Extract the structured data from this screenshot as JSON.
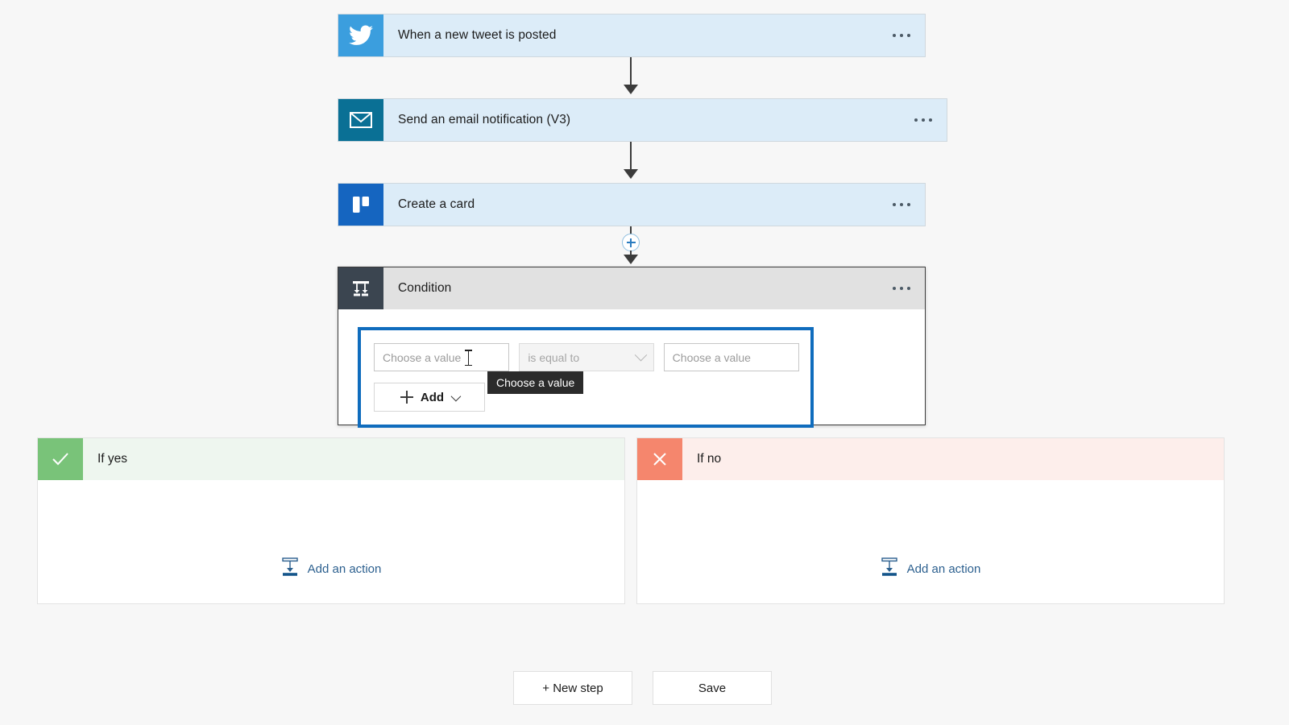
{
  "theme": {
    "page_background": "#f7f7f7",
    "card_background": "#dcecf8",
    "condition_header_background": "#e1e1e1",
    "focus_border": "#0f6cbd",
    "yes_accent": "#79c379",
    "no_accent": "#f5866d",
    "link_color": "#2b5f8e",
    "tooltip_background": "#2b2b2b"
  },
  "flow": {
    "steps": [
      {
        "id": "trigger-tweet",
        "title": "When a new tweet is posted",
        "icon": "twitter-icon",
        "icon_color": "#3b9ede",
        "menu": "overflow-menu-icon"
      },
      {
        "id": "send-email",
        "title": "Send an email notification (V3)",
        "icon": "email-icon",
        "icon_color": "#0a7095",
        "menu": "overflow-menu-icon"
      },
      {
        "id": "create-card",
        "title": "Create a card",
        "icon": "trello-icon",
        "icon_color": "#1565c0",
        "menu": "overflow-menu-icon"
      }
    ],
    "insert_button": {
      "icon": "plus-circle-icon",
      "label": "+"
    },
    "condition": {
      "title": "Condition",
      "icon": "condition-branch-icon",
      "icon_background": "#3b4550",
      "menu": "overflow-menu-icon",
      "row": {
        "left_value": {
          "placeholder": "Choose a value",
          "value": "",
          "cursor": "text-ibeam-cursor"
        },
        "operator": {
          "value": "is equal to",
          "chevron": "chevron-down-icon"
        },
        "right_value": {
          "placeholder": "Choose a value",
          "value": ""
        }
      },
      "add_button": {
        "label": "Add",
        "plus": "plus-icon",
        "chevron": "chevron-down-icon"
      },
      "tooltip": {
        "text": "Choose a value"
      }
    },
    "branches": [
      {
        "id": "if-yes",
        "label": "If yes",
        "icon": "checkmark-icon",
        "add_action": {
          "label": "Add an action",
          "icon": "add-action-icon"
        }
      },
      {
        "id": "if-no",
        "label": "If no",
        "icon": "close-x-icon",
        "add_action": {
          "label": "Add an action",
          "icon": "add-action-icon"
        }
      }
    ]
  },
  "footer": {
    "new_step_label": "+ New step",
    "save_label": "Save"
  }
}
